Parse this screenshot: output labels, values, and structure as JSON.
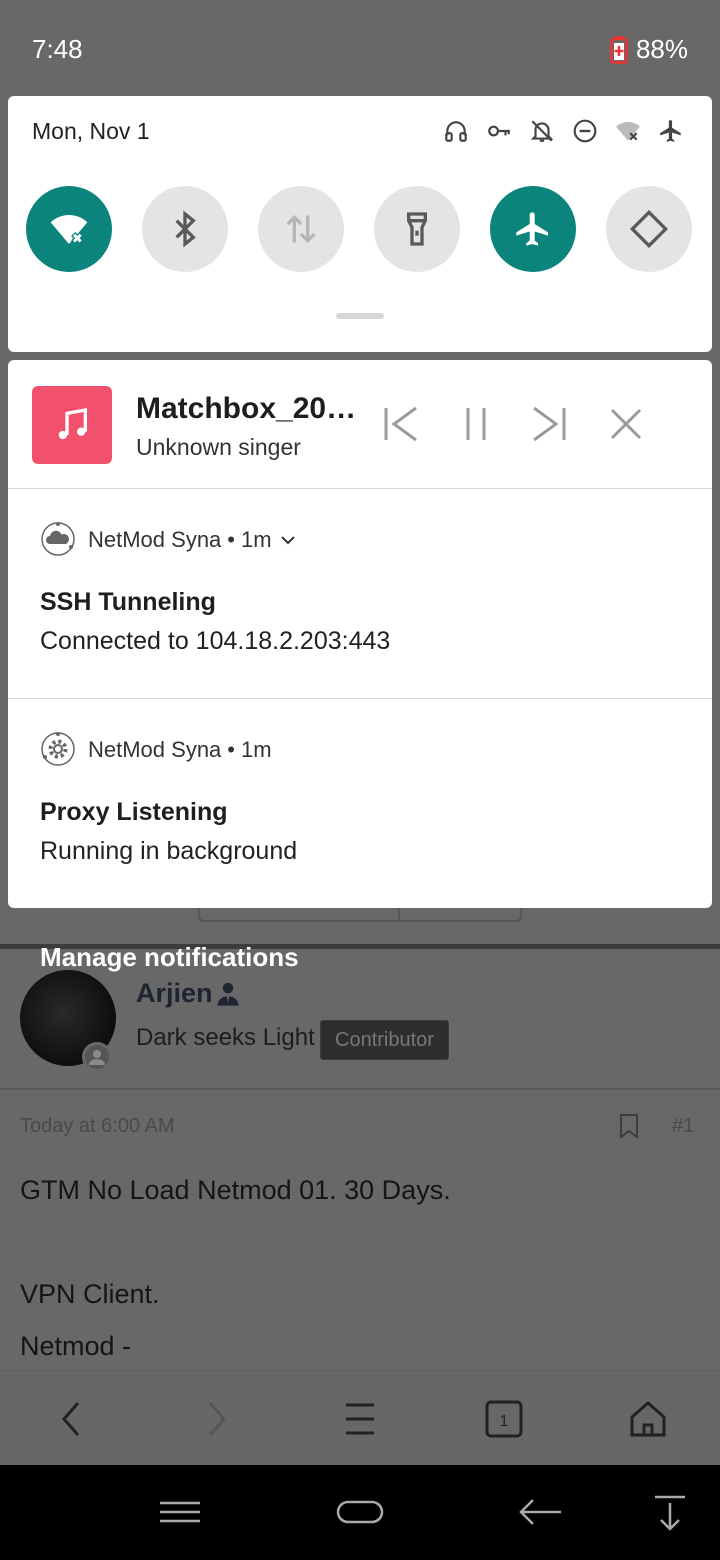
{
  "status_bar": {
    "time": "7:48",
    "battery": "88%"
  },
  "quick_settings": {
    "date": "Mon, Nov 1",
    "status_icons": [
      "headphones-icon",
      "vpn-key-icon",
      "notifications-off-icon",
      "dnd-icon",
      "wifi-off-icon",
      "airplane-icon"
    ],
    "tiles": [
      {
        "name": "wifi",
        "state": "on"
      },
      {
        "name": "bluetooth",
        "state": "off"
      },
      {
        "name": "mobile-data",
        "state": "off"
      },
      {
        "name": "flashlight",
        "state": "off"
      },
      {
        "name": "airplane-mode",
        "state": "on"
      },
      {
        "name": "auto-rotate",
        "state": "off"
      }
    ],
    "accent_color": "#0b847c"
  },
  "media": {
    "title": "Matchbox_20_...",
    "artist": "Unknown singer",
    "art_color": "#f2516e"
  },
  "notifications": [
    {
      "app": "NetMod Syna",
      "time": "1m",
      "title": "SSH Tunneling",
      "text": "Connected to 104.18.2.203:443"
    },
    {
      "app": "NetMod Syna",
      "time": "1m",
      "title": "Proxy Listening",
      "text": "Running in background"
    }
  ],
  "manage_label": "Manage notifications",
  "background_page": {
    "username": "Arjien",
    "tagline": "Dark seeks Light",
    "badge": "Contributor",
    "date": "Today at 6:00 AM",
    "post_number": "#1",
    "lines": [
      "GTM No Load Netmod 01. 30 Days.",
      "VPN Client.",
      "Netmod -"
    ],
    "tab_count": "1"
  }
}
